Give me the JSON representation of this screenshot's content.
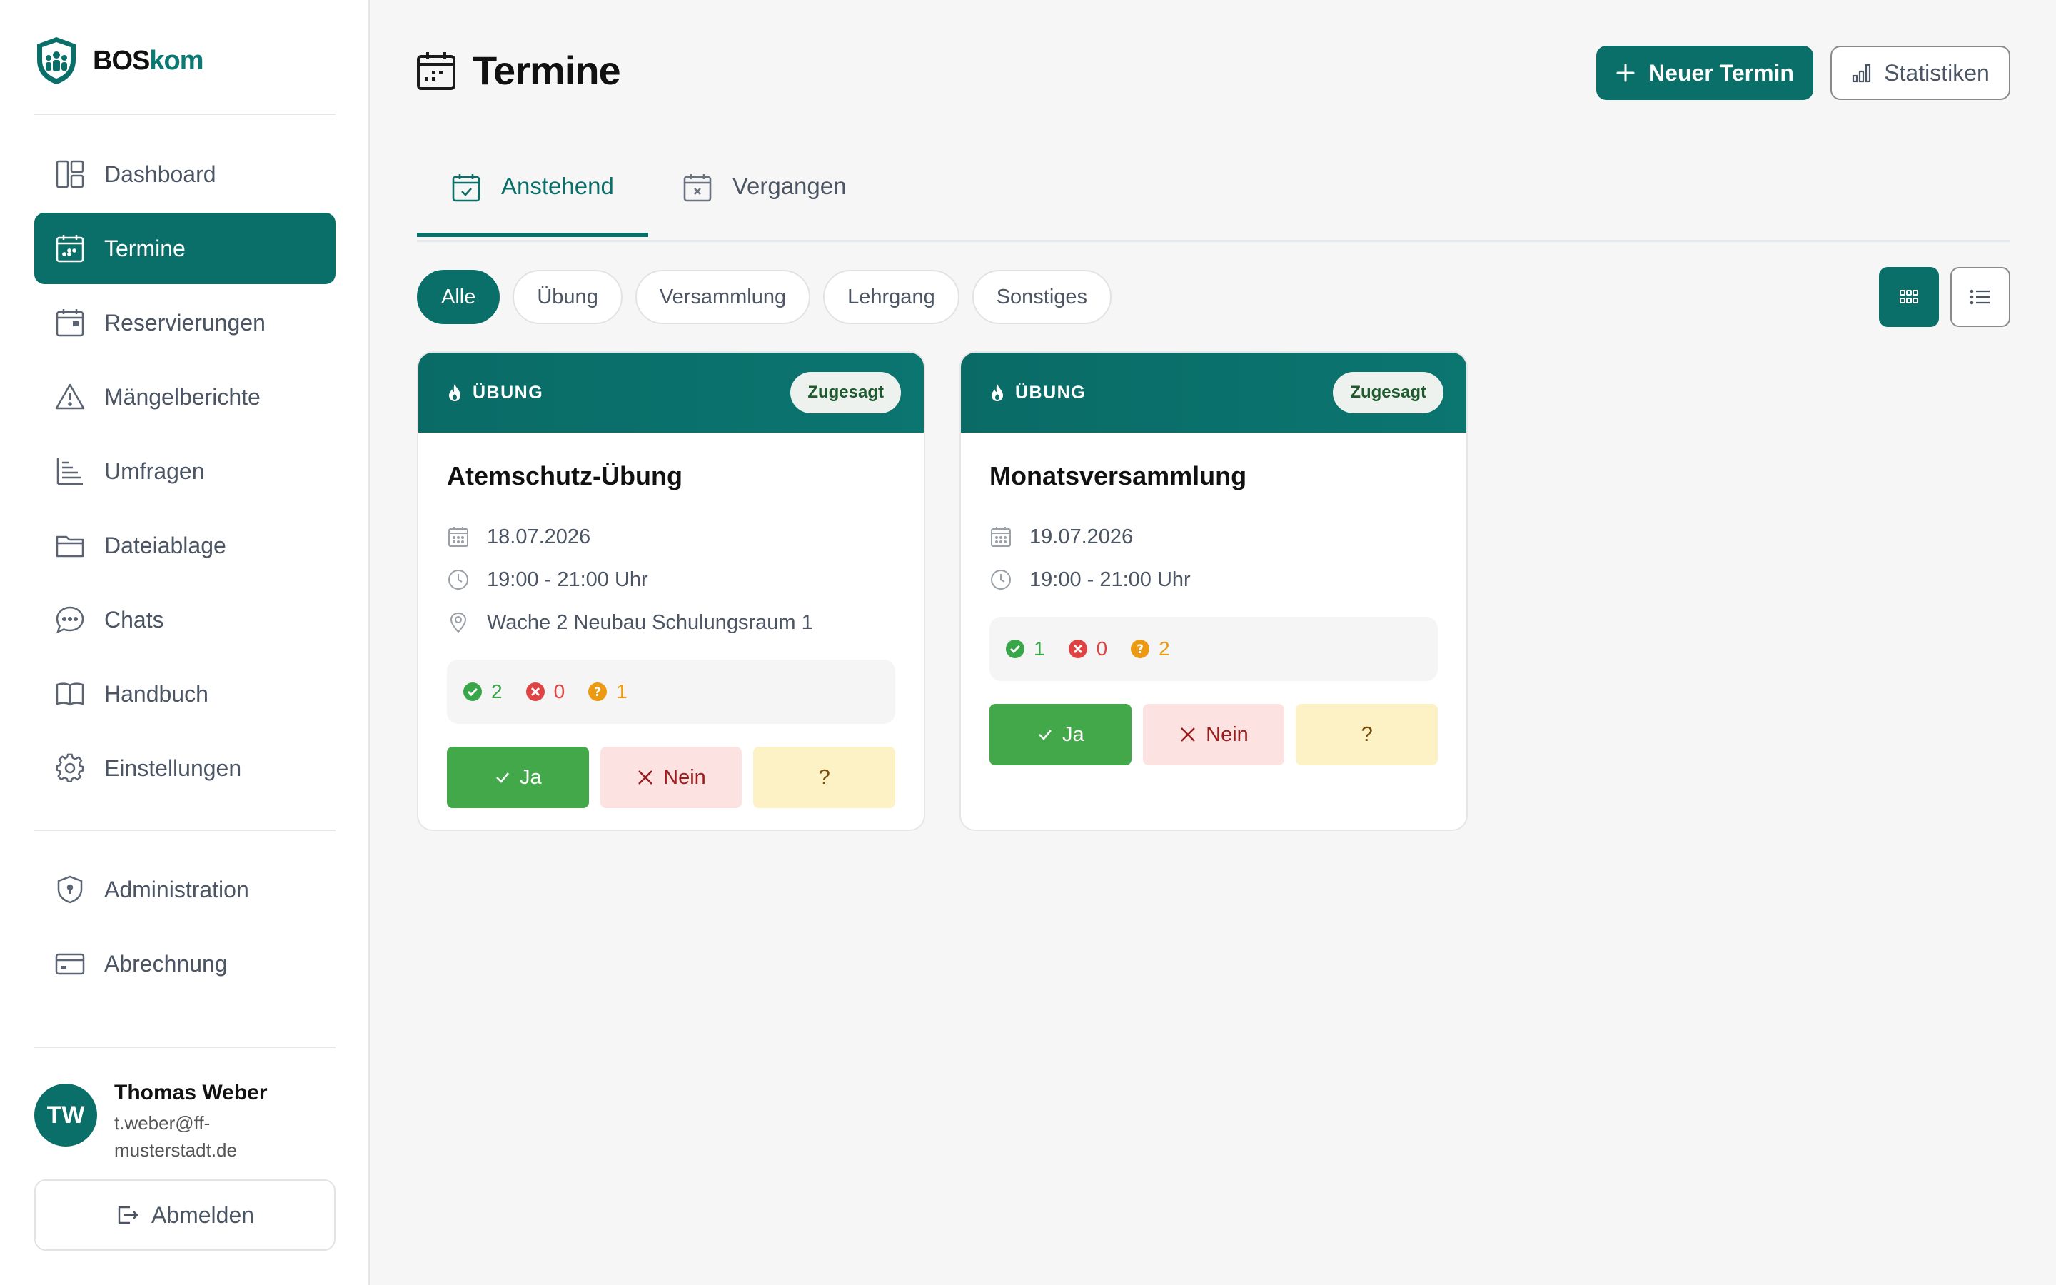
{
  "brand": {
    "prefix": "BOS",
    "suffix": "kom",
    "accent": "#0b6f69"
  },
  "sidebar": {
    "items": [
      {
        "label": "Dashboard",
        "icon": "layout-icon",
        "active": false
      },
      {
        "label": "Termine",
        "icon": "calendar-icon",
        "active": true
      },
      {
        "label": "Reservierungen",
        "icon": "calendar-booking-icon",
        "active": false
      },
      {
        "label": "Mängelberichte",
        "icon": "warning-icon",
        "active": false
      },
      {
        "label": "Umfragen",
        "icon": "survey-icon",
        "active": false
      },
      {
        "label": "Dateiablage",
        "icon": "folder-icon",
        "active": false
      },
      {
        "label": "Chats",
        "icon": "chat-icon",
        "active": false
      },
      {
        "label": "Handbuch",
        "icon": "book-icon",
        "active": false
      },
      {
        "label": "Einstellungen",
        "icon": "gear-icon",
        "active": false
      }
    ],
    "admin_items": [
      {
        "label": "Administration",
        "icon": "shield-icon"
      },
      {
        "label": "Abrechnung",
        "icon": "credit-card-icon"
      }
    ],
    "user": {
      "initials": "TW",
      "name": "Thomas Weber",
      "email": "t.weber@ff-musterstadt.de"
    },
    "logout_label": "Abmelden"
  },
  "header": {
    "title": "Termine",
    "new_button": "Neuer Termin",
    "stats_button": "Statistiken"
  },
  "tabs": [
    {
      "label": "Anstehend",
      "active": true
    },
    {
      "label": "Vergangen",
      "active": false
    }
  ],
  "filters": [
    {
      "label": "Alle",
      "active": true
    },
    {
      "label": "Übung",
      "active": false
    },
    {
      "label": "Versammlung",
      "active": false
    },
    {
      "label": "Lehrgang",
      "active": false
    },
    {
      "label": "Sonstiges",
      "active": false
    }
  ],
  "view": {
    "mode": "grid"
  },
  "cards": [
    {
      "type": "ÜBUNG",
      "status": "Zugesagt",
      "title": "Atemschutz-Übung",
      "date": "18.07.2026",
      "time": "19:00 - 21:00 Uhr",
      "location": "Wache 2 Neubau Schulungsraum 1",
      "yes": "2",
      "no": "0",
      "maybe": "1",
      "btn_yes": "Ja",
      "btn_no": "Nein",
      "btn_maybe": "?"
    },
    {
      "type": "ÜBUNG",
      "status": "Zugesagt",
      "title": "Monatsversammlung",
      "date": "19.07.2026",
      "time": "19:00 - 21:00 Uhr",
      "yes": "1",
      "no": "0",
      "maybe": "2",
      "btn_yes": "Ja",
      "btn_no": "Nein",
      "btn_maybe": "?"
    }
  ]
}
